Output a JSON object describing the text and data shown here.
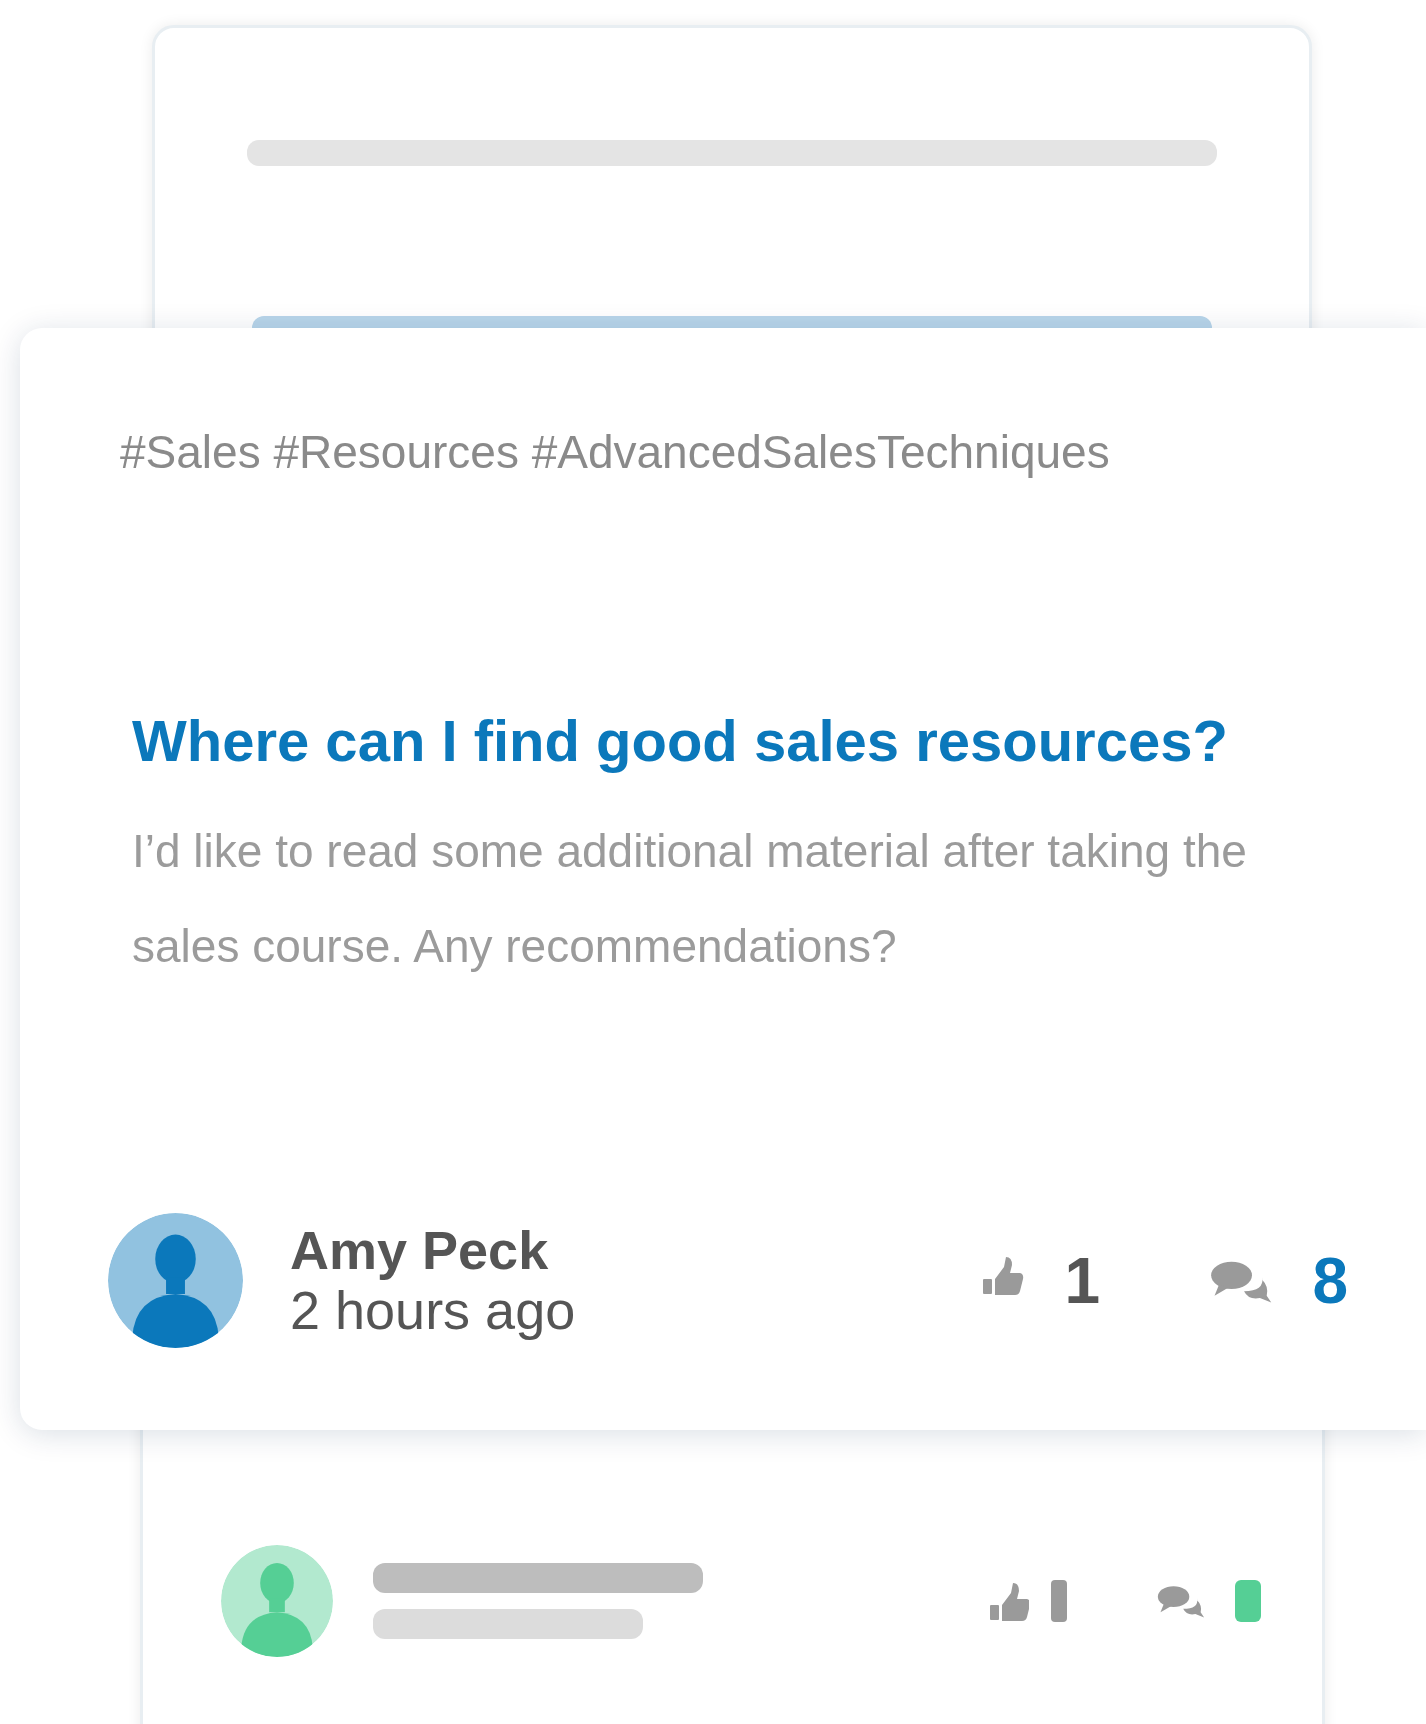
{
  "cards": [
    {
      "kind": "blurred"
    },
    {
      "kind": "focused",
      "tags": "#Sales #Resources #AdvancedSalesTechniques",
      "title": "Where can I find good sales resources?",
      "body": "I’d like to read some additional material after taking the sales course. Any recommendations?",
      "author": "Amy Peck",
      "time": "2 hours ago",
      "likes": "1",
      "comments": "8",
      "color": "#0b78bb"
    },
    {
      "kind": "blurred",
      "color": "#55cf95"
    }
  ]
}
